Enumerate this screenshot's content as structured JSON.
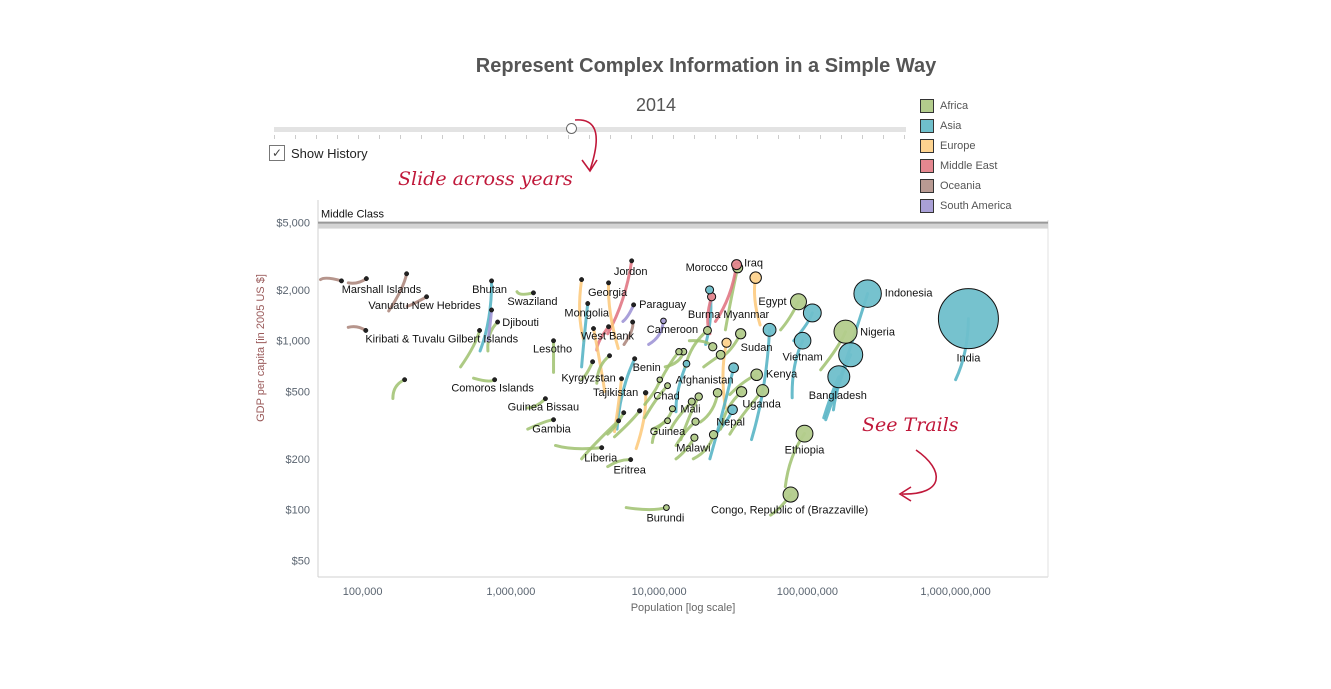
{
  "title": "Represent Complex Information in a Simple Way",
  "year_slider": {
    "year": "2014",
    "position_fraction": 0.47
  },
  "show_history": {
    "label": "Show History",
    "checked": true,
    "check_glyph": "✓"
  },
  "annotations": {
    "slide": "Slide across years",
    "trails": "See Trails"
  },
  "legend": [
    {
      "label": "Africa",
      "color": "#b3cc8c"
    },
    {
      "label": "Asia",
      "color": "#6fbfcb"
    },
    {
      "label": "Europe",
      "color": "#fdd38f"
    },
    {
      "label": "Middle East",
      "color": "#e4878f"
    },
    {
      "label": "Oceania",
      "color": "#b89a92"
    },
    {
      "label": "South America",
      "color": "#a9a0d6"
    }
  ],
  "chart_data": {
    "type": "scatter",
    "title": "Represent Complex Information in a Simple Way",
    "xlabel": "Population [log scale]",
    "ylabel": "GDP per capita [in 2005 US $]",
    "x_scale": "log",
    "y_scale": "log",
    "xlim": [
      50000,
      4200000000
    ],
    "ylim": [
      40,
      6800
    ],
    "x_ticks": [
      {
        "value": 100000,
        "label": "100,000"
      },
      {
        "value": 1000000,
        "label": "1,000,000"
      },
      {
        "value": 10000000,
        "label": "10,000,000"
      },
      {
        "value": 100000000,
        "label": "100,000,000"
      },
      {
        "value": 1000000000,
        "label": "1,000,000,000"
      }
    ],
    "y_ticks": [
      {
        "value": 5000,
        "label": "$5,000"
      },
      {
        "value": 2000,
        "label": "$2,000"
      },
      {
        "value": 1000,
        "label": "$1,000"
      },
      {
        "value": 500,
        "label": "$500"
      },
      {
        "value": 200,
        "label": "$200"
      },
      {
        "value": 100,
        "label": "$100"
      },
      {
        "value": 50,
        "label": "$50"
      }
    ],
    "reference_band": {
      "label": "Middle Class",
      "value": 5000
    },
    "size_encodes": "population",
    "grid": false,
    "legend_placement": "top-right",
    "points": [
      {
        "name": "Marshall Islands",
        "region": "Oceania",
        "pop": 72000,
        "gdp": 2260,
        "trail_from": [
          52000,
          2300
        ]
      },
      {
        "name": "",
        "region": "Oceania",
        "pop": 106000,
        "gdp": 2330,
        "trail_from": [
          80000,
          2200
        ]
      },
      {
        "name": "",
        "region": "Oceania",
        "pop": 198000,
        "gdp": 2490,
        "trail_from": [
          150000,
          1500
        ]
      },
      {
        "name": "Vanuatu New Hebrides",
        "region": "Oceania",
        "pop": 270000,
        "gdp": 1820,
        "trail_from": [
          200000,
          1600
        ]
      },
      {
        "name": "Kiribati & Tuvalu Gilbert Islands",
        "region": "Oceania",
        "pop": 105000,
        "gdp": 1150,
        "trail_from": [
          80000,
          1200
        ]
      },
      {
        "name": "Bhutan",
        "region": "Asia",
        "pop": 741000,
        "gdp": 2260,
        "trail_from": [
          620000,
          870
        ]
      },
      {
        "name": "Djibouti",
        "region": "Africa",
        "pop": 814000,
        "gdp": 1290,
        "trail_from": [
          700000,
          870
        ]
      },
      {
        "name": "",
        "region": "South America",
        "pop": 741000,
        "gdp": 1520,
        "trail_from": [
          700000,
          1000
        ]
      },
      {
        "name": "",
        "region": "Africa",
        "pop": 615000,
        "gdp": 1150,
        "trail_from": [
          458000,
          700
        ]
      },
      {
        "name": "Swaziland",
        "region": "Africa",
        "pop": 1420000,
        "gdp": 1920,
        "trail_from": [
          1100000,
          1950
        ]
      },
      {
        "name": "Lesotho",
        "region": "Africa",
        "pop": 1940000,
        "gdp": 1000,
        "trail_from": [
          1940000,
          650
        ]
      },
      {
        "name": "Comoros Islands",
        "region": "Africa",
        "pop": 777000,
        "gdp": 588,
        "trail_from": [
          560000,
          600
        ]
      },
      {
        "name": "",
        "region": "Africa",
        "pop": 192000,
        "gdp": 588,
        "trail_from": [
          160000,
          455
        ]
      },
      {
        "name": "Guinea Bissau",
        "region": "Africa",
        "pop": 1710000,
        "gdp": 454,
        "trail_from": [
          1300000,
          400
        ]
      },
      {
        "name": "Gambia",
        "region": "Africa",
        "pop": 1940000,
        "gdp": 341,
        "trail_from": [
          1300000,
          300
        ]
      },
      {
        "name": "",
        "region": "Europe",
        "pop": 3000000,
        "gdp": 2300,
        "trail_from": [
          3100000,
          1000
        ]
      },
      {
        "name": "Mongolia",
        "region": "Asia",
        "pop": 3300000,
        "gdp": 1660,
        "trail_from": [
          3000000,
          700
        ]
      },
      {
        "name": "Jordon",
        "region": "Middle East",
        "pop": 6530000,
        "gdp": 2970,
        "trail_from": [
          4500000,
          1100
        ]
      },
      {
        "name": "Georgia",
        "region": "Europe",
        "pop": 4560000,
        "gdp": 2200,
        "trail_from": [
          5300000,
          900
        ]
      },
      {
        "name": "Paraguay",
        "region": "South America",
        "pop": 6730000,
        "gdp": 1630,
        "trail_from": [
          5700000,
          1300
        ]
      },
      {
        "name": "",
        "region": "Oceania",
        "pop": 6630000,
        "gdp": 1290,
        "trail_from": [
          5800000,
          950
        ]
      },
      {
        "name": "West Bank",
        "region": "Middle East",
        "pop": 4560000,
        "gdp": 1210,
        "trail_from": [
          3800000,
          880
        ]
      },
      {
        "name": "",
        "region": "Europe",
        "pop": 3610000,
        "gdp": 1180,
        "trail_from": [
          4300000,
          500
        ]
      },
      {
        "name": "Cameroon",
        "region": "South America",
        "pop": 10700000,
        "gdp": 1310,
        "trail_from": [
          8500000,
          950
        ]
      },
      {
        "name": "Benin",
        "region": "Asia",
        "pop": 6840000,
        "gdp": 782,
        "trail_from": [
          5200000,
          300
        ]
      },
      {
        "name": "Kyrgyzstan",
        "region": "Europe",
        "pop": 5580000,
        "gdp": 596,
        "trail_from": [
          5000000,
          290
        ]
      },
      {
        "name": "Tajikistan",
        "region": "Europe",
        "pop": 8110000,
        "gdp": 492,
        "trail_from": [
          7000000,
          230
        ]
      },
      {
        "name": "Afghanistan",
        "region": "Asia",
        "pop": 15300000,
        "gdp": 731,
        "trail_from": [
          13000000,
          380
        ]
      },
      {
        "name": "Chad",
        "region": "Africa",
        "pop": 11400000,
        "gdp": 542,
        "trail_from": [
          8000000,
          350
        ]
      },
      {
        "name": "Mali",
        "region": "Africa",
        "pop": 12300000,
        "gdp": 396,
        "trail_from": [
          9000000,
          300
        ]
      },
      {
        "name": "Guinea",
        "region": "Africa",
        "pop": 11400000,
        "gdp": 336,
        "trail_from": [
          9000000,
          250
        ]
      },
      {
        "name": "Malawi",
        "region": "Africa",
        "pop": 17300000,
        "gdp": 267,
        "trail_from": [
          13000000,
          200
        ]
      },
      {
        "name": "Nepal",
        "region": "Asia",
        "pop": 31300000,
        "gdp": 391,
        "trail_from": [
          24000000,
          280
        ]
      },
      {
        "name": "Uganda",
        "region": "Africa",
        "pop": 49900000,
        "gdp": 506,
        "trail_from": [
          30000000,
          280
        ]
      },
      {
        "name": "Kenya",
        "region": "Africa",
        "pop": 45500000,
        "gdp": 629,
        "trail_from": [
          30000000,
          480
        ]
      },
      {
        "name": "Sudan",
        "region": "Asia",
        "pop": 55600000,
        "gdp": 1160,
        "trail_from": [
          42000000,
          260
        ]
      },
      {
        "name": "Vietnam",
        "region": "Asia",
        "pop": 92900000,
        "gdp": 1000,
        "trail_from": [
          79000000,
          460
        ]
      },
      {
        "name": "Egypt",
        "region": "Africa",
        "pop": 87100000,
        "gdp": 1700,
        "trail_from": [
          66000000,
          1160
        ]
      },
      {
        "name": "Burma Myanmar",
        "region": "Asia",
        "pop": 21900000,
        "gdp": 2000,
        "trail_from": [
          20600000,
          950
        ]
      },
      {
        "name": "",
        "region": "Middle East",
        "pop": 22600000,
        "gdp": 1820,
        "trail_from": [
          22000000,
          1100
        ]
      },
      {
        "name": "Morocco",
        "region": "Africa",
        "pop": 33900000,
        "gdp": 2700,
        "trail_from": [
          28000000,
          1160
        ]
      },
      {
        "name": "Iraq",
        "region": "Middle East",
        "pop": 33300000,
        "gdp": 2820,
        "trail_from": [
          24000000,
          1300
        ]
      },
      {
        "name": "",
        "region": "Europe",
        "pop": 44800000,
        "gdp": 2360,
        "trail_from": [
          48000000,
          1240
        ]
      },
      {
        "name": "Indonesia",
        "region": "Asia",
        "pop": 255000000,
        "gdp": 1900,
        "trail_from": [
          133000000,
          341
        ]
      },
      {
        "name": "Nigeria",
        "region": "Africa",
        "pop": 181000000,
        "gdp": 1130,
        "trail_from": [
          123000000,
          673
        ]
      },
      {
        "name": "",
        "region": "Asia",
        "pop": 196000000,
        "gdp": 826,
        "trail_from": [
          150000000,
          390
        ]
      },
      {
        "name": "Bangladesh",
        "region": "Asia",
        "pop": 163000000,
        "gdp": 612,
        "trail_from": [
          129000000,
          350
        ]
      },
      {
        "name": "India",
        "region": "Asia",
        "pop": 1220000000,
        "gdp": 1350,
        "trail_from": [
          1000000000,
          588
        ]
      },
      {
        "name": "Ethiopia",
        "region": "Africa",
        "pop": 95700000,
        "gdp": 282,
        "trail_from": [
          71000000,
          137
        ]
      },
      {
        "name": "Congo, Republic of (Brazzaville)",
        "region": "Africa",
        "pop": 77100000,
        "gdp": 123,
        "trail_from": [
          56500000,
          93
        ]
      },
      {
        "name": "",
        "region": "Asia",
        "pop": 108000000,
        "gdp": 1460,
        "trail_from": [
          81000000,
          1000
        ]
      },
      {
        "name": "Liberia",
        "region": "Africa",
        "pop": 4100000,
        "gdp": 233,
        "trail_from": [
          2000000,
          240
        ]
      },
      {
        "name": "Eritrea",
        "region": "Africa",
        "pop": 6430000,
        "gdp": 198,
        "trail_from": [
          4500000,
          180
        ]
      },
      {
        "name": "Burundi",
        "region": "Africa",
        "pop": 11200000,
        "gdp": 103,
        "trail_from": [
          6000000,
          103
        ]
      },
      {
        "name": "",
        "region": "Africa",
        "pop": 21200000,
        "gdp": 1150,
        "trail_from": [
          15000000,
          700
        ]
      },
      {
        "name": "",
        "region": "Africa",
        "pop": 35500000,
        "gdp": 1100,
        "trail_from": [
          28000000,
          830
        ]
      },
      {
        "name": "",
        "region": "Africa",
        "pop": 23000000,
        "gdp": 921,
        "trail_from": [
          16000000,
          1000
        ]
      },
      {
        "name": "",
        "region": "Africa",
        "pop": 26000000,
        "gdp": 826,
        "trail_from": [
          20000000,
          700
        ]
      },
      {
        "name": "",
        "region": "Africa",
        "pop": 13600000,
        "gdp": 861,
        "trail_from": [
          10000000,
          560
        ]
      },
      {
        "name": "",
        "region": "Africa",
        "pop": 14600000,
        "gdp": 861,
        "trail_from": [
          11000000,
          700
        ]
      },
      {
        "name": "",
        "region": "Africa",
        "pop": 4630000,
        "gdp": 815,
        "trail_from": [
          3800000,
          560
        ]
      },
      {
        "name": "",
        "region": "Africa",
        "pop": 3560000,
        "gdp": 751,
        "trail_from": [
          3000000,
          590
        ]
      },
      {
        "name": "",
        "region": "Africa",
        "pop": 10100000,
        "gdp": 588,
        "trail_from": [
          8000000,
          420
        ]
      },
      {
        "name": "",
        "region": "Africa",
        "pop": 16600000,
        "gdp": 436,
        "trail_from": [
          12000000,
          300
        ]
      },
      {
        "name": "",
        "region": "Africa",
        "pop": 18500000,
        "gdp": 467,
        "trail_from": [
          14000000,
          260
        ]
      },
      {
        "name": "",
        "region": "Africa",
        "pop": 24800000,
        "gdp": 492,
        "trail_from": [
          19000000,
          330
        ]
      },
      {
        "name": "",
        "region": "Africa",
        "pop": 36000000,
        "gdp": 499,
        "trail_from": [
          26000000,
          300
        ]
      },
      {
        "name": "",
        "region": "Africa",
        "pop": 5770000,
        "gdp": 375,
        "trail_from": [
          4500000,
          280
        ]
      },
      {
        "name": "",
        "region": "Africa",
        "pop": 7390000,
        "gdp": 385,
        "trail_from": [
          5000000,
          270
        ]
      },
      {
        "name": "",
        "region": "Africa",
        "pop": 5330000,
        "gdp": 336,
        "trail_from": [
          3000000,
          200
        ]
      },
      {
        "name": "",
        "region": "Africa",
        "pop": 17600000,
        "gdp": 332,
        "trail_from": [
          13000000,
          240
        ]
      },
      {
        "name": "",
        "region": "Africa",
        "pop": 23300000,
        "gdp": 278,
        "trail_from": [
          17000000,
          200
        ]
      },
      {
        "name": "",
        "region": "Europe",
        "pop": 28500000,
        "gdp": 973,
        "trail_from": [
          28000000,
          400
        ]
      },
      {
        "name": "",
        "region": "Asia",
        "pop": 31800000,
        "gdp": 692,
        "trail_from": [
          22000000,
          200
        ]
      }
    ]
  }
}
